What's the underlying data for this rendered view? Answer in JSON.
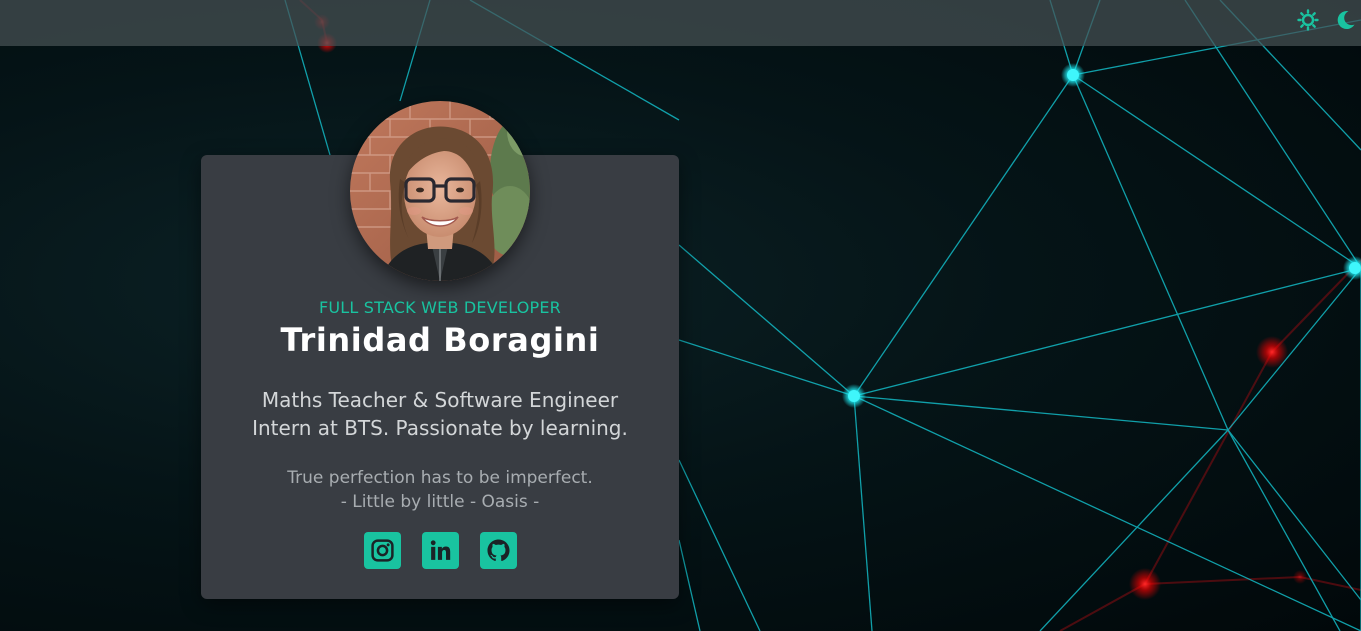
{
  "colors": {
    "accent": "#19c3a0",
    "network_line": "#12c8d4",
    "network_node": "#26f0f6",
    "red_glow": "#ff1010",
    "card_bg": "#393d43",
    "topbar_bg": "#46525480"
  },
  "header": {
    "toggles": [
      {
        "icon": "sun-icon",
        "label": "light theme"
      },
      {
        "icon": "moon-icon",
        "label": "dark theme"
      }
    ]
  },
  "profile": {
    "role": "FULL STACK WEB DEVELOPER",
    "name": "Trinidad Boragini",
    "bio_line1": "Maths Teacher & Software Engineer",
    "bio_line2": "Intern at BTS. Passionate by learning.",
    "quote_line1": "True perfection has to be imperfect.",
    "quote_line2": "- Little by little - Oasis -",
    "avatar": "profile-photo"
  },
  "socials": [
    {
      "name": "instagram",
      "icon": "instagram-icon"
    },
    {
      "name": "linkedin",
      "icon": "linkedin-icon"
    },
    {
      "name": "github",
      "icon": "github-icon"
    }
  ]
}
